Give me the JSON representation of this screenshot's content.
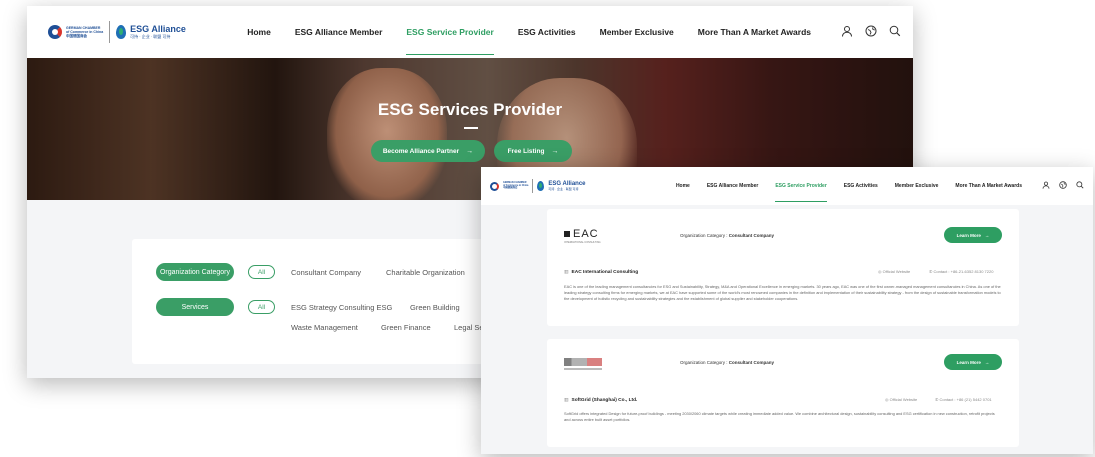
{
  "brand": {
    "gc_lines": [
      "GERMAN CHAMBER",
      "of Commerce in China",
      "中国德国商会"
    ],
    "esg_title": "ESG Alliance",
    "esg_sub": "可持 · 企业 · 联盟 可持"
  },
  "nav": {
    "items": [
      {
        "label": "Home"
      },
      {
        "label": "ESG Alliance Member"
      },
      {
        "label": "ESG Service Provider",
        "active": true
      },
      {
        "label": "ESG Activities"
      },
      {
        "label": "Member Exclusive"
      },
      {
        "label": "More Than A Market Awards"
      }
    ],
    "icons": [
      "user-icon",
      "globe-icon",
      "search-icon"
    ]
  },
  "hero": {
    "title": "ESG Services Provider",
    "buttons": [
      "Become Alliance Partner",
      "Free Listing"
    ],
    "arrow": "→"
  },
  "filters": {
    "category_label": "Organization Category",
    "services_label": "Services",
    "all_label": "All",
    "category_options": [
      "Consultant Company",
      "Charitable Organization"
    ],
    "service_options_row1": [
      "ESG Strategy Consulting ESG",
      "Green Building"
    ],
    "service_options_row2": [
      "Waste Management",
      "Green Finance",
      "Legal Se"
    ]
  },
  "listings": [
    {
      "logo_text": "EAC",
      "logo_sub": "INTERNATIONAL CONSULTING",
      "category_label": "Organization Category :",
      "category_value": "Consultant Company",
      "button": "Learn More",
      "name": "EAC International Consulting",
      "website_label": "Official Website",
      "contact_label": "Contact :",
      "contact_value": "+86-21-6352 8130 7220",
      "description": "EAC is one of the leading management consultancies for ESG and Sustainability, Strategy, M&A and Operational Excellence in emerging markets. 30 years ago, EAC was one of the first owner-managed management consultancies in China. As one of the leading strategy consulting firms for emerging markets, we at EAC have supported some of the world's most renowned companies in the definition and implementation of their sustainability strategy - from the design of sustainable transformation models to the development of holistic recycling and sustainability strategies and the establishment of global supplier and stakeholder cooperations."
    },
    {
      "logo_text": "",
      "category_label": "Organization Category :",
      "category_value": "Consultant Company",
      "button": "Learn More",
      "name": "SoftGrid (Shanghai) Co., Ltd.",
      "website_label": "Official Website",
      "contact_label": "Contact :",
      "contact_value": "+86 (21) 5442 0701",
      "description": "SoftGrid offers integrated Design for future-proof buildings - meeting 2030/2060 climate targets while creating immediate added value. We combine architectural design, sustainability consulting and ESG certification in new construction, retrofit projects and across entire built asset portfolios."
    }
  ],
  "colors": {
    "accent": "#2e9e62",
    "brand_blue": "#1f4f96",
    "brand_red": "#d9342b"
  }
}
